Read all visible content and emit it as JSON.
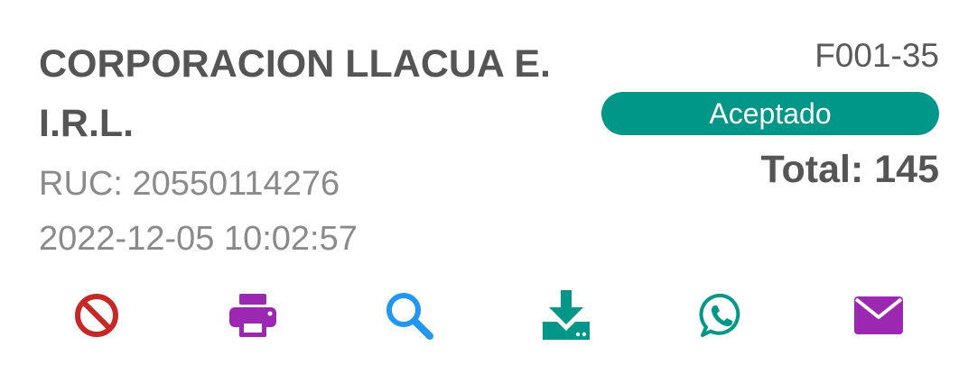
{
  "invoice": {
    "company_name": "CORPORACION LLACUA E. I.R.L.",
    "ruc": "RUC: 20550114276",
    "datetime": "2022-12-05 10:02:57",
    "serie": "F001-35",
    "status": "Aceptado",
    "total": "Total: 145"
  },
  "colors": {
    "status_badge": "#009688",
    "cancel": "#c62828",
    "print": "#9c27b0",
    "search": "#2196f3",
    "download": "#009688",
    "whatsapp": "#009688",
    "email": "#9c27b0"
  },
  "actions": [
    {
      "name": "cancel",
      "icon": "ban-icon"
    },
    {
      "name": "print",
      "icon": "printer-icon"
    },
    {
      "name": "search",
      "icon": "search-icon"
    },
    {
      "name": "download",
      "icon": "download-icon"
    },
    {
      "name": "whatsapp",
      "icon": "whatsapp-icon"
    },
    {
      "name": "email",
      "icon": "envelope-icon"
    }
  ]
}
